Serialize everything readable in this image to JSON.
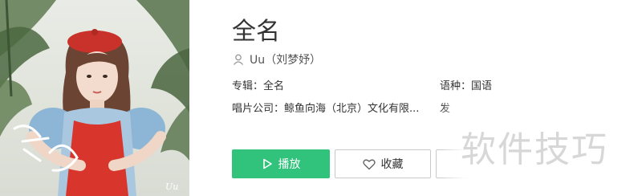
{
  "song": {
    "title": "全名",
    "artist": "Uu（刘梦妤）"
  },
  "meta": {
    "album_label": "专辑：",
    "album_value": "全名",
    "language_label": "语种：",
    "language_value": "国语",
    "company_label": "唱片公司：",
    "company_value": "鲸鱼向海（北京）文化有限...",
    "issue_label_partial": "发"
  },
  "buttons": {
    "play_label": "播放",
    "favorite_label": "收藏"
  },
  "cover": {
    "script_text": "全名",
    "artist_text": "Uu"
  },
  "watermark": {
    "text": "软件技巧"
  },
  "colors": {
    "accent": "#31c27c",
    "text": "#333333",
    "muted": "#999999"
  },
  "icons": {
    "artist": "user-icon",
    "play": "play-icon",
    "favorite": "heart-icon"
  }
}
